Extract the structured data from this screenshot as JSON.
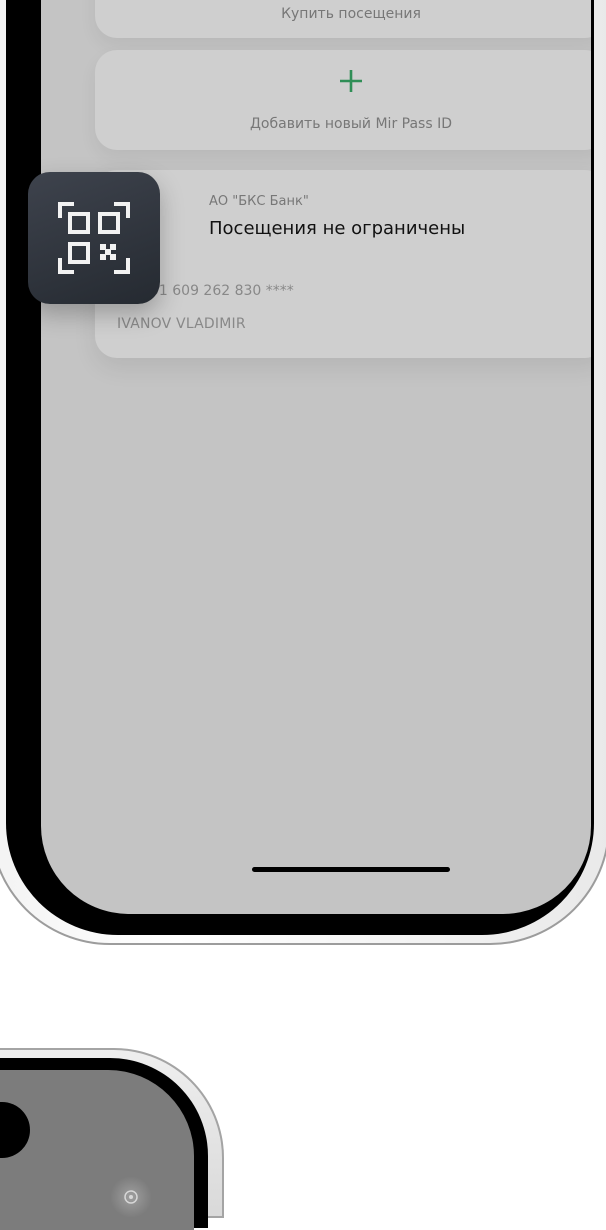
{
  "screen": {
    "buy_visits": {
      "label": "Купить посещения",
      "icon": "ruble-plus-icon",
      "accent": "#2f8e56"
    },
    "add_mirpass": {
      "label": "Добавить новый Mir Pass ID",
      "icon": "plus-icon",
      "accent": "#2f8e56"
    },
    "pass_card": {
      "bank": "АО \"БКС Банк\"",
      "status": "Посещения не ограничены",
      "id": "ID: 101 609 262 830 ****",
      "holder": "IVANOV VLADIMIR"
    }
  },
  "qr_button": {
    "icon": "qr-code-icon"
  }
}
